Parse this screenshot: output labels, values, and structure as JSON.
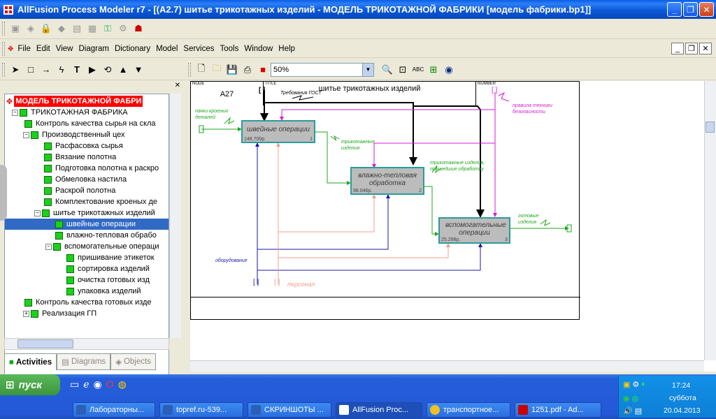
{
  "window": {
    "title": "AllFusion Process Modeler r7 - [(A2.7) шитье  трикотажных  изделий - МОДЕЛЬ ТРИКОТАЖНОЙ ФАБРИКИ  [модель фабрики.bp1]]"
  },
  "menu": [
    "File",
    "Edit",
    "View",
    "Diagram",
    "Dictionary",
    "Model",
    "Services",
    "Tools",
    "Window",
    "Help"
  ],
  "toolbar": {
    "zoom_value": "50%"
  },
  "tree": {
    "root": "МОДЕЛЬ ТРИКОТАЖНОЙ ФАБРИ",
    "items": [
      "ТРИКОТАЖНАЯ ФАБРИКА",
      "Контроль качества  сырья на скла",
      "Производственный цех",
      "Расфасовка  сырья",
      "Вязание  полотна",
      "Подготовка  полотна к раскро",
      "Обмеловка  настила",
      "Раскрой полотна",
      "Комплектование  кроеных  де",
      "шитье  трикотажных  изделий",
      "швейные  операции",
      "влажно-тепловая  обрабо",
      "вспомогательные  операци",
      "пришивание  этикеток",
      "сортировка  изделий",
      "очистка  готовых    изд",
      "упаковка  изделий",
      "Контроль качества  готовых изде",
      "Реализация  ГП"
    ]
  },
  "tabs": {
    "activities": "Activities",
    "diagrams": "Diagrams",
    "objects": "Objects"
  },
  "diagram": {
    "boxes": [
      {
        "title": "швейные  операции",
        "cost": "148.700р.",
        "num": "1"
      },
      {
        "title": "влажно-тепловая  обработка",
        "cost": "98.046р.",
        "num": "2"
      },
      {
        "title": "вспомогательные  операции",
        "cost": "25.298р.",
        "num": "3"
      }
    ],
    "labels": {
      "gost": "Требования ГОСТ",
      "safety": "правила техники безопасности",
      "cut_parts": "пачки кроеных деталей",
      "knit_items": "трикотажные изделия",
      "processed_items": "трикотажные изделия, прошедшие обработку",
      "finished": "готовые изделия",
      "equipment": "оборудование",
      "staff": "персонал",
      "tunnel1": "[ ]",
      "tunnel2": "[ ]",
      "tunnel3": "[ ]",
      "tunnel4": "[ ]"
    },
    "footer": {
      "node_caption": "NODE",
      "node_value": "A27",
      "title_caption": "TITLE",
      "title_value": "шитье  трикотажных  изделий",
      "number_caption": "NUMBER"
    }
  },
  "taskbar": {
    "start": "пуск",
    "tasks": [
      "Лабораторны...",
      "topref.ru-539...",
      "СКРИНШОТЫ ...",
      "AllFusion Proc...",
      "транспортное...",
      "1251.pdf - Ad..."
    ],
    "clock": {
      "time": "17:24",
      "day": "суббота",
      "date": "20.04.2013"
    }
  }
}
